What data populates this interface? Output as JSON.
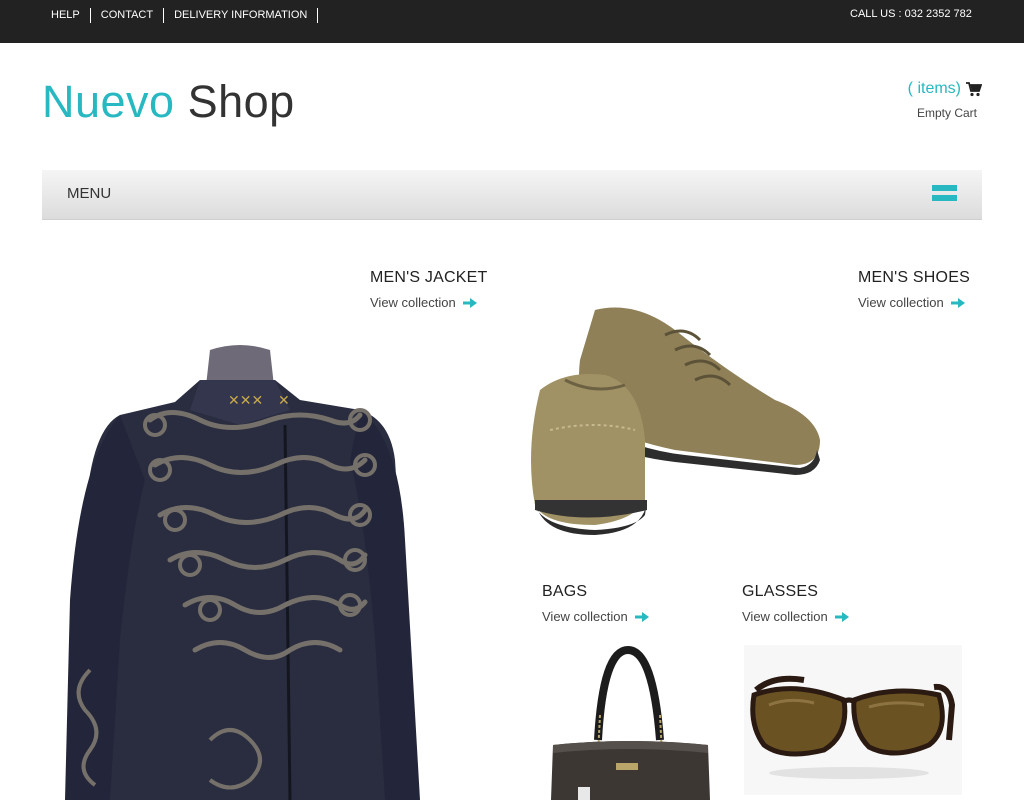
{
  "topbar": {
    "links": [
      {
        "label": "HELP"
      },
      {
        "label": "CONTACT"
      },
      {
        "label": "DELIVERY INFORMATION"
      }
    ],
    "call_us": "CALL US : 032 2352 782"
  },
  "header": {
    "logo_part1": "Nuevo",
    "logo_part2": "Shop",
    "cart_items": "( items)",
    "cart_status": "Empty Cart"
  },
  "menu": {
    "label": "MENU"
  },
  "collections": [
    {
      "title": "MEN'S JACKET",
      "link": "View collection",
      "image": "mens-jacket-image"
    },
    {
      "title": "MEN'S SHOES",
      "link": "View collection",
      "image": "mens-shoes-image"
    },
    {
      "title": "BAGS",
      "link": "View collection",
      "image": "bag-image"
    },
    {
      "title": "GLASSES",
      "link": "View collection",
      "image": "sunglasses-image"
    }
  ],
  "colors": {
    "accent": "#27b8c2",
    "topbar": "#222222",
    "text": "#333333"
  },
  "icons": {
    "cart": "cart-icon",
    "menu": "hamburger-icon",
    "arrow": "arrow-right-icon"
  }
}
